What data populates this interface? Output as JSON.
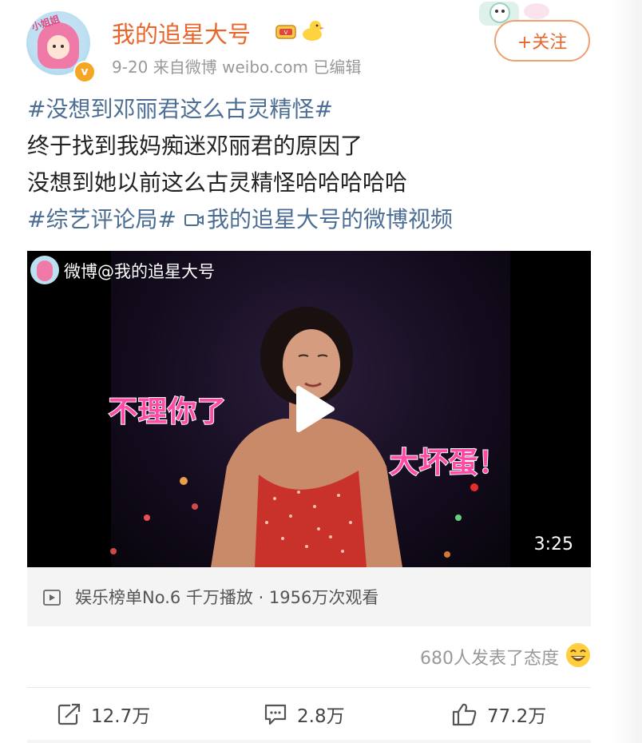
{
  "header": {
    "username": "我的追星大号",
    "meta": "9-20  来自微博 weibo.com  已编辑",
    "follow_label": "+关注",
    "avatar_scribble": "小姐姐"
  },
  "post": {
    "topic1": "#没想到邓丽君这么古灵精怪#",
    "line2": "终于找到我妈痴迷邓丽君的原因了",
    "line3": "没想到她以前这么古灵精怪哈哈哈哈哈",
    "topic2": "#综艺评论局#",
    "video_link": "我的追星大号的微博视频"
  },
  "video": {
    "watermark": "微博@我的追星大号",
    "subtitle_left": "不理你了",
    "subtitle_right": "大坏蛋！",
    "duration": "3:25",
    "stats": "娱乐榜单No.6 千万播放 · 1956万次观看"
  },
  "attitude": "680人发表了态度",
  "actions": {
    "repost": "12.7万",
    "comment": "2.8万",
    "like": "77.2万"
  },
  "colors": {
    "username": "#e8662a",
    "topic": "#4d6e94",
    "subtitle": "#ff4aa6"
  }
}
